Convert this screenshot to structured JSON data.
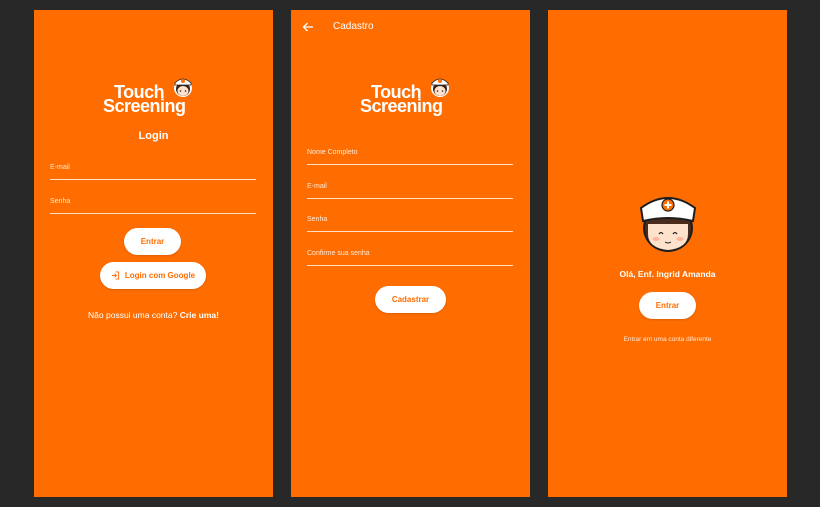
{
  "brand": {
    "line1": "Touch",
    "line2": "Screening"
  },
  "login": {
    "title": "Login",
    "email_label": "E-mail",
    "password_label": "Senha",
    "enter_button": "Entrar",
    "google_button": "Login com Google",
    "no_account_text": "Não possui uma conta?",
    "create_link": "Crie uma!"
  },
  "register": {
    "appbar_title": "Cadastro",
    "fullname_label": "Nome Completo",
    "email_label": "E-mail",
    "password_label": "Senha",
    "confirm_label": "Confirme sua senha",
    "submit_button": "Cadastrar"
  },
  "welcome": {
    "greeting": "Olá, Enf. Ingrid Amanda",
    "enter_button": "Entrar",
    "other_account_link": "Entrar em uma conta diferente"
  },
  "colors": {
    "background": "#282828",
    "primary": "#ff6d00",
    "white": "#ffffff"
  },
  "icons": {
    "back": "arrow-left-icon",
    "login": "login-icon",
    "avatar": "nurse-avatar-icon"
  }
}
